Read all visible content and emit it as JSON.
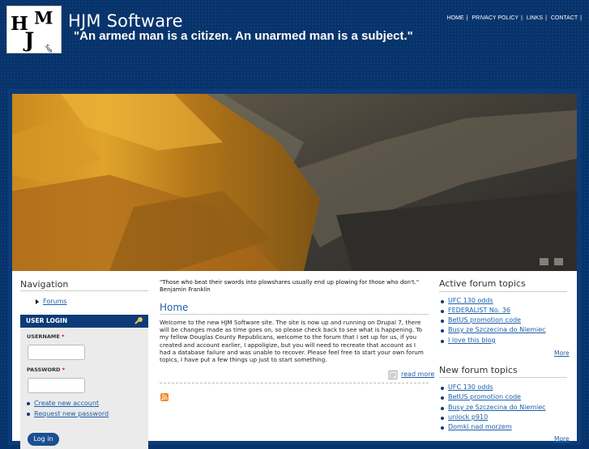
{
  "header": {
    "site_name": "HJM Software",
    "slogan": "\"An armed man is a citizen. An unarmed man is a subject.\"",
    "logo_icon": "hjm-software-logo-icon"
  },
  "topnav": {
    "items": [
      {
        "label": "HOME"
      },
      {
        "label": "PRIVACY POLICY"
      },
      {
        "label": "LINKS"
      },
      {
        "label": "CONTACT"
      }
    ]
  },
  "navigation": {
    "title": "Navigation",
    "items": [
      {
        "label": "Forums"
      }
    ]
  },
  "login": {
    "title": "USER LOGIN",
    "username_label": "USERNAME",
    "password_label": "PASSWORD",
    "required_mark": "*",
    "username_value": "",
    "password_value": "",
    "links": [
      {
        "label": "Create new account"
      },
      {
        "label": "Request new password"
      }
    ],
    "submit_label": "Log in"
  },
  "main": {
    "quote_line1": "\"Those who beat their swords into plowshares usually end up plowing for those who don't.\"",
    "quote_line2": "Benjamin Franklin",
    "title": "Home",
    "body": "Welcome to the new HJM Software site. The site is now up and running on Drupal 7, there will be changes made as time goes on, so please check back to see what is happening. To my fellow Douglas County Republicans, welcome to the forum that I set up for us, if you created and account earlier, I appoligize, but you will need to recreate that account as I had a database failure and was unable to recover. Please feel free to start your own forum topics, I have put a few things up just to start something.",
    "read_more": "read more"
  },
  "active_topics": {
    "title": "Active forum topics",
    "items": [
      {
        "label": "UFC 130 odds"
      },
      {
        "label": "FEDERALIST No. 36"
      },
      {
        "label": "BetUS promotion code"
      },
      {
        "label": "Busy ze Szczecina do Niemiec"
      },
      {
        "label": "I love this blog"
      }
    ],
    "more": "More"
  },
  "new_topics": {
    "title": "New forum topics",
    "items": [
      {
        "label": "UFC 130 odds"
      },
      {
        "label": "BetUS promotion code"
      },
      {
        "label": "Busy ze Szczecina do Niemiec"
      },
      {
        "label": "unlock p910"
      },
      {
        "label": "Domki nad morzem"
      }
    ],
    "more": "More"
  },
  "colors": {
    "background": "#06336b",
    "accent": "#0c3b78",
    "link": "#1d5fab"
  }
}
